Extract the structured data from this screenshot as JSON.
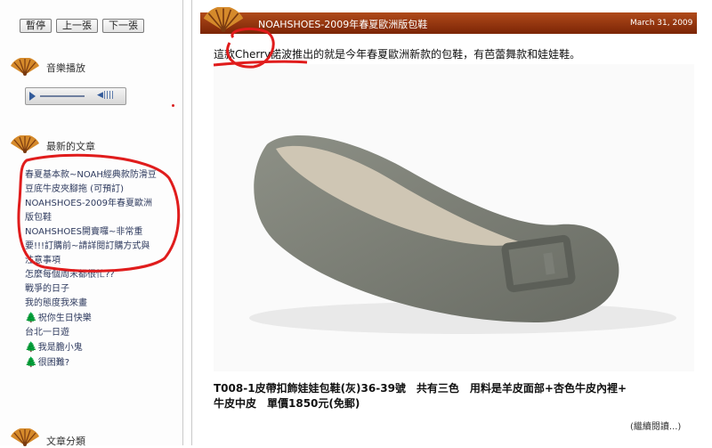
{
  "sidebar": {
    "buttons": [
      "暫停",
      "上一張",
      "下一張"
    ],
    "music_heading": "音樂播放",
    "recent_heading": "最新的文章",
    "recent_posts": [
      {
        "text": "春夏基本款~NOAH經典款防滑豆",
        "icon": false
      },
      {
        "text": "豆底牛皮夾腳拖 (可預訂)",
        "icon": false
      },
      {
        "text": "NOAHSHOES-2009年春夏歐洲",
        "icon": false
      },
      {
        "text": "版包鞋",
        "icon": false
      },
      {
        "text": "NOAHSHOES開賣囉~非常重",
        "icon": false
      },
      {
        "text": "要!!!訂購前~請詳閱訂購方式與",
        "icon": false
      },
      {
        "text": "注意事項",
        "icon": false
      },
      {
        "text": "怎麼每個周末都很忙??",
        "icon": false
      },
      {
        "text": "戰爭的日子",
        "icon": false
      },
      {
        "text": "我的態度我來畫",
        "icon": false
      },
      {
        "text": "祝你生日快樂",
        "icon": true
      },
      {
        "text": "台北一日遊",
        "icon": false
      },
      {
        "text": "我是膽小鬼",
        "icon": true
      },
      {
        "text": "很困難?",
        "icon": true
      }
    ],
    "category_heading": "文章分類"
  },
  "post": {
    "title": "NOAHSHOES-2009年春夏歐洲版包鞋",
    "date": "March 31, 2009",
    "intro": "這款Cherry諾波推出的就是今年春夏歐洲新款的包鞋，有芭蕾舞款和娃娃鞋。",
    "caption_line1": "T008-1皮帶扣飾娃娃包鞋(灰)36-39號　共有三色　用料是羊皮面部+杏色牛皮內裡+",
    "caption_line2": "牛皮中皮　單價1850元(免郵)",
    "read_more": "(繼續閱讀...)"
  },
  "colors": {
    "header_bg": "#8f3a12",
    "annotation_red": "#e01c1c",
    "shoe_gray": "#7f8278"
  },
  "icons": [
    "fan-icon",
    "play-icon",
    "volume-icon",
    "tree-icon"
  ]
}
